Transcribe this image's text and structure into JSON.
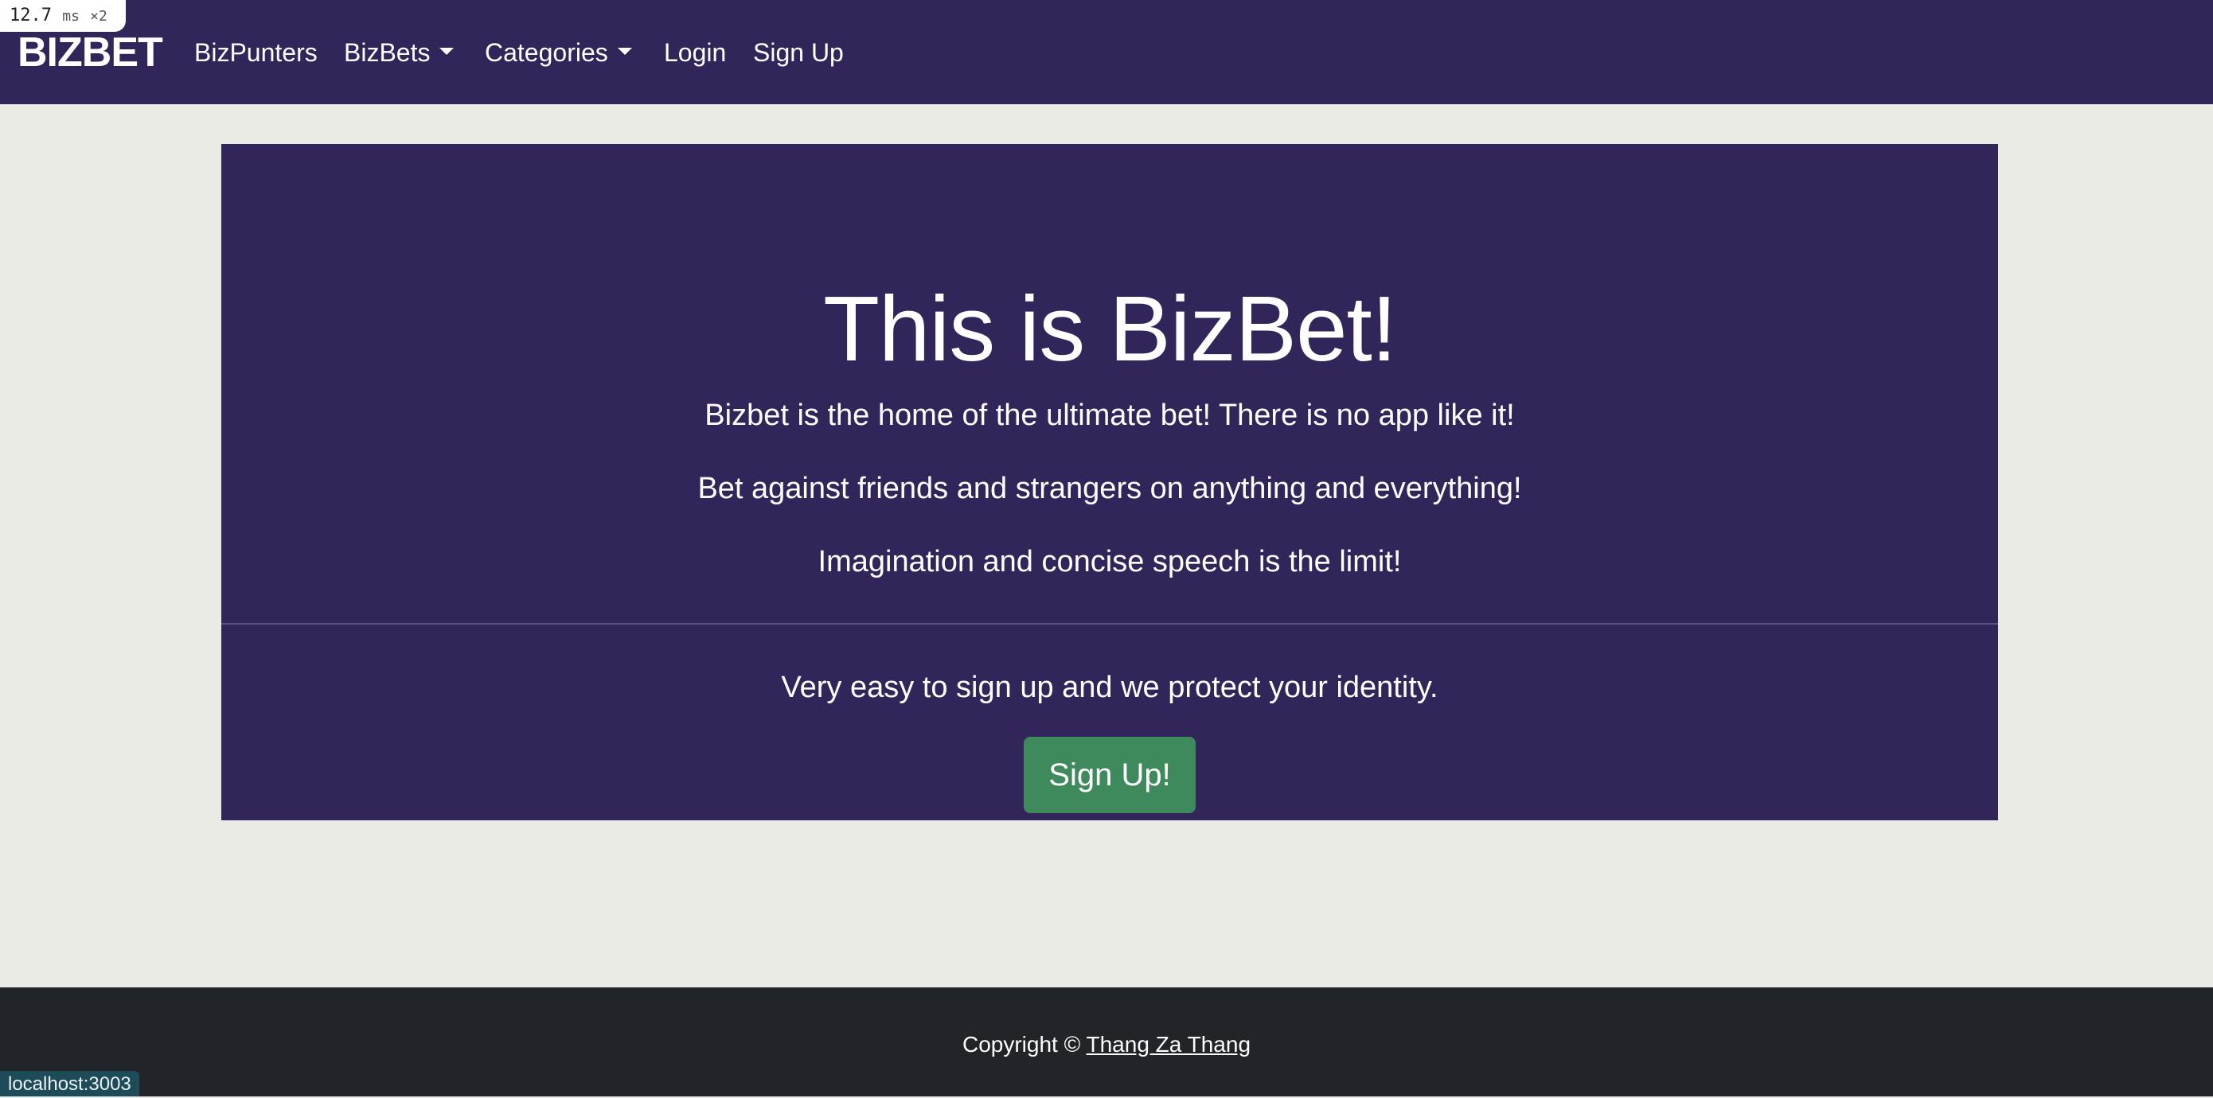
{
  "perf_overlay": {
    "value": "12.7",
    "unit": "ms",
    "multiplier": "×2"
  },
  "navbar": {
    "brand": "BIZBET",
    "links": [
      {
        "label": "BizPunters",
        "dropdown": false
      },
      {
        "label": "BizBets",
        "dropdown": true
      },
      {
        "label": "Categories",
        "dropdown": true
      },
      {
        "label": "Login",
        "dropdown": false
      },
      {
        "label": "Sign Up",
        "dropdown": false
      }
    ]
  },
  "hero": {
    "title": "This is BizBet!",
    "lines": [
      "Bizbet is the home of the ultimate bet! There is no app like it!",
      "Bet against friends and strangers on anything and everything!",
      "Imagination and concise speech is the limit!"
    ],
    "signup_text": "Very easy to sign up and we protect your identity.",
    "signup_button": "Sign Up!"
  },
  "footer": {
    "copyright_prefix": "Copyright ©",
    "author_link": "Thang Za Thang"
  },
  "status_bar": {
    "url": "localhost:3003"
  },
  "colors": {
    "navbar_bg": "#32255a",
    "page_bg": "#e9ebe4",
    "hero_bg": "#32255a",
    "button_bg": "#3e8a5c",
    "footer_bg": "#212529"
  }
}
